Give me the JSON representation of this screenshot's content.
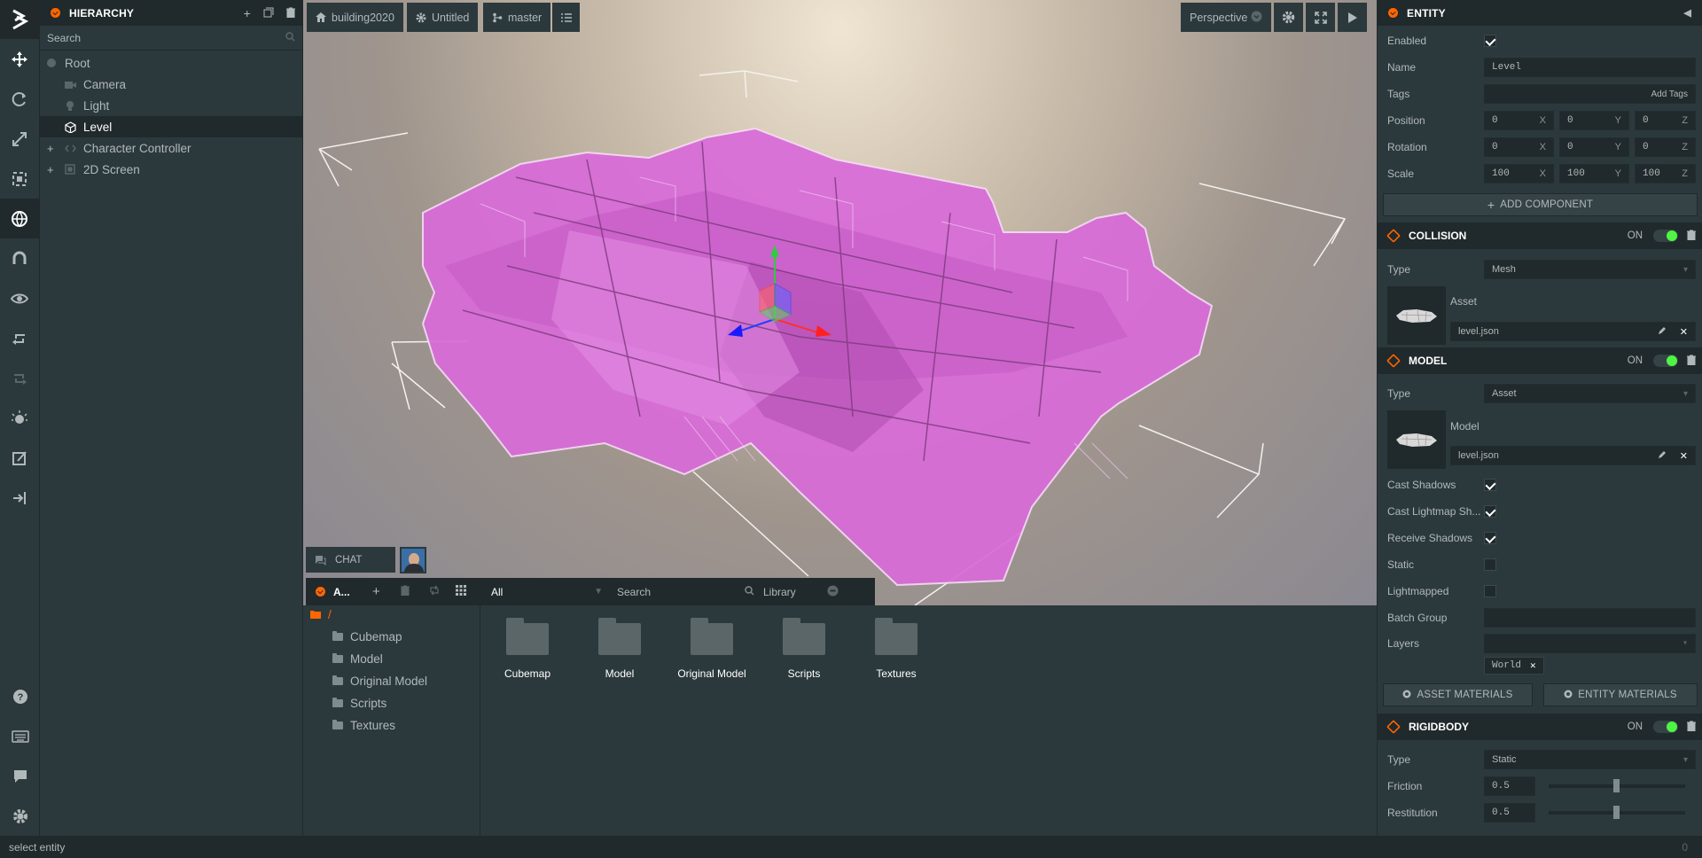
{
  "toolbar": {
    "items": [
      "translate-icon",
      "rotate-icon",
      "scale-icon",
      "resize-icon",
      "world-icon",
      "magnet-icon",
      "eye-icon",
      "redo-icon",
      "undo-icon",
      "light-icon",
      "edit-icon",
      "publish-icon"
    ],
    "bottom_items": [
      "help-icon",
      "keyboard-icon",
      "feedback-icon",
      "settings-icon"
    ]
  },
  "hierarchy": {
    "title": "HIERARCHY",
    "search_placeholder": "Search",
    "items": [
      {
        "label": "Root"
      },
      {
        "label": "Camera"
      },
      {
        "label": "Light"
      },
      {
        "label": "Level"
      },
      {
        "label": "Character Controller"
      },
      {
        "label": "2D Screen"
      }
    ]
  },
  "viewport": {
    "project": "building2020",
    "scene": "Untitled",
    "branch": "master",
    "camera": "Perspective"
  },
  "chat": {
    "label": "CHAT"
  },
  "assets": {
    "title": "A...",
    "filter": "All",
    "search_placeholder": "Search",
    "library": "Library",
    "root": "/",
    "folders": [
      "Cubemap",
      "Model",
      "Original Model",
      "Scripts",
      "Textures"
    ]
  },
  "inspector": {
    "entity": {
      "title": "ENTITY",
      "enabled_label": "Enabled",
      "name_label": "Name",
      "name_value": "Level",
      "tags_label": "Tags",
      "add_tags": "Add Tags",
      "position_label": "Position",
      "position": [
        "0",
        "0",
        "0"
      ],
      "rotation_label": "Rotation",
      "rotation": [
        "0",
        "0",
        "0"
      ],
      "scale_label": "Scale",
      "scale": [
        "100",
        "100",
        "100"
      ],
      "axes": [
        "X",
        "Y",
        "Z"
      ],
      "add_component": "ADD COMPONENT"
    },
    "collision": {
      "title": "COLLISION",
      "on": "ON",
      "type_label": "Type",
      "type_value": "Mesh",
      "asset_label": "Asset",
      "asset_value": "level.json"
    },
    "model": {
      "title": "MODEL",
      "on": "ON",
      "type_label": "Type",
      "type_value": "Asset",
      "model_label": "Model",
      "model_value": "level.json",
      "cast_shadows": "Cast Shadows",
      "cast_lightmap": "Cast Lightmap Sh...",
      "receive_shadows": "Receive Shadows",
      "static": "Static",
      "lightmapped": "Lightmapped",
      "batch_group": "Batch Group",
      "layers": "Layers",
      "layer_chip": "World",
      "asset_materials": "ASSET MATERIALS",
      "entity_materials": "ENTITY MATERIALS"
    },
    "rigidbody": {
      "title": "RIGIDBODY",
      "on": "ON",
      "type_label": "Type",
      "type_value": "Static",
      "friction_label": "Friction",
      "friction_value": "0.5",
      "restitution_label": "Restitution",
      "restitution_value": "0.5"
    }
  },
  "status": {
    "text": "select entity",
    "right": "0"
  }
}
